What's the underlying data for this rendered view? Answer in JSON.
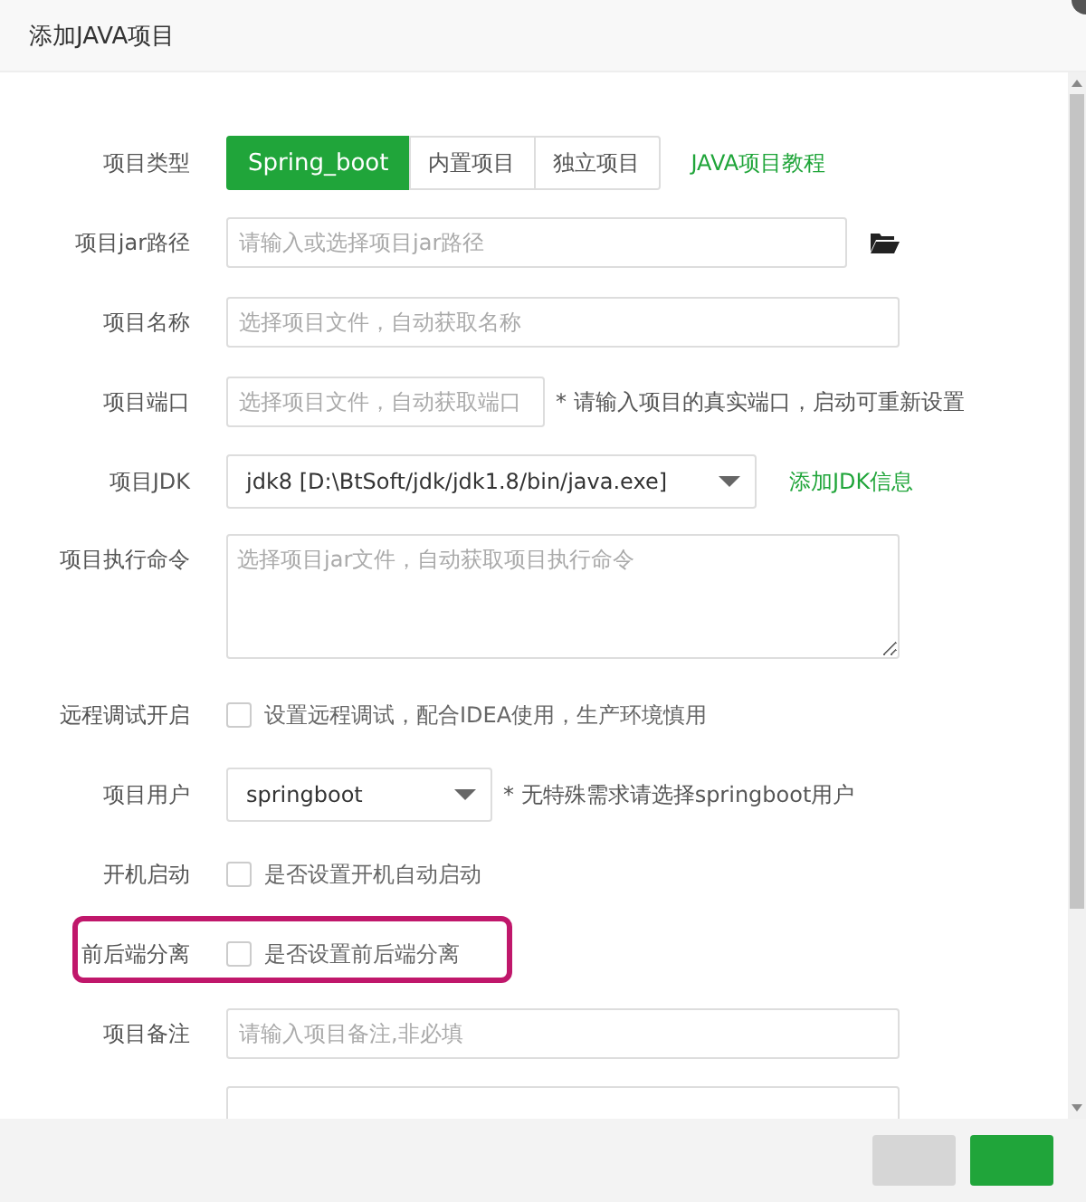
{
  "window": {
    "title": "添加JAVA项目"
  },
  "type_row": {
    "label": "项目类型",
    "options": [
      {
        "label": "Spring_boot",
        "selected": true
      },
      {
        "label": "内置项目",
        "selected": false
      },
      {
        "label": "独立项目",
        "selected": false
      }
    ],
    "link": "JAVA项目教程"
  },
  "fields": [
    {
      "kind": "input",
      "label": "项目jar路径",
      "placeholder": "请输入或选择项目jar路径",
      "browse": true
    },
    {
      "kind": "input",
      "label": "项目名称",
      "placeholder": "选择项目文件，自动获取名称"
    },
    {
      "kind": "input",
      "label": "项目端口",
      "placeholder": "选择项目文件，自动获取端口",
      "note": "* 请输入项目的真实端口，启动可重新设置"
    },
    {
      "kind": "select",
      "label": "项目JDK",
      "value": "jdk8 [D:\\BtSoft/jdk/jdk1.8/bin/java.exe]",
      "link": "添加JDK信息"
    },
    {
      "kind": "textarea",
      "label": "项目执行命令",
      "placeholder": "选择项目jar文件，自动获取项目执行命令"
    },
    {
      "kind": "checkbox",
      "label": "远程调试开启",
      "text": "设置远程调试，配合IDEA使用，生产环境慎用",
      "checked": false
    },
    {
      "kind": "select",
      "label": "项目用户",
      "value": "springboot",
      "note": "* 无特殊需求请选择springboot用户"
    },
    {
      "kind": "checkbox",
      "label": "开机启动",
      "text": "是否设置开机自动启动",
      "checked": false
    },
    {
      "kind": "checkbox",
      "label": "前后端分离",
      "text": "是否设置前后端分离",
      "checked": false,
      "highlighted": true
    },
    {
      "kind": "input",
      "label": "项目备注",
      "placeholder": "请输入项目备注,非必填"
    },
    {
      "kind": "input"
    }
  ]
}
